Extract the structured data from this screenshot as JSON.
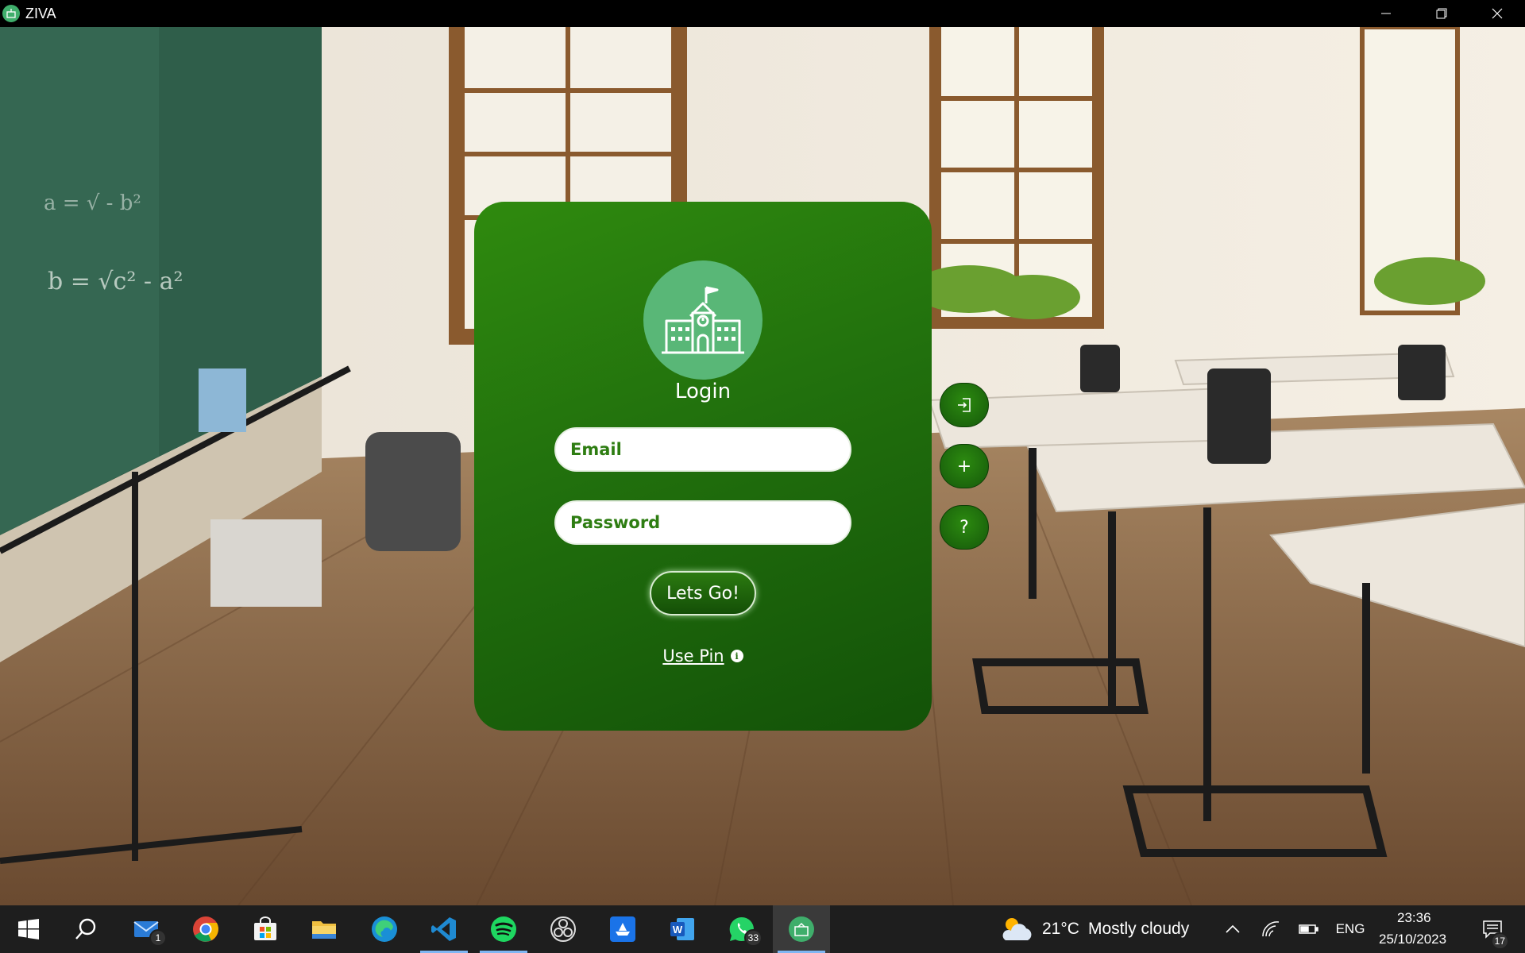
{
  "window": {
    "title": "ZIVA"
  },
  "login": {
    "title": "Login",
    "email_placeholder": "Email",
    "password_placeholder": "Password",
    "submit_label": "Lets Go!",
    "use_pin_label": "Use Pin",
    "info_glyph": "i"
  },
  "side_buttons": [
    {
      "name": "login",
      "icon": "sign-in-icon"
    },
    {
      "name": "add",
      "glyph": "+"
    },
    {
      "name": "help",
      "glyph": "?"
    }
  ],
  "taskbar": {
    "apps": [
      {
        "name": "start",
        "icon": "windows-icon"
      },
      {
        "name": "search",
        "icon": "search-icon"
      },
      {
        "name": "mail",
        "icon": "mail-icon",
        "badge": "1"
      },
      {
        "name": "chrome",
        "icon": "chrome-icon"
      },
      {
        "name": "store",
        "icon": "store-icon"
      },
      {
        "name": "file-explorer",
        "icon": "folder-icon"
      },
      {
        "name": "edge",
        "icon": "edge-icon"
      },
      {
        "name": "vscode",
        "icon": "vscode-icon"
      },
      {
        "name": "spotify",
        "icon": "spotify-icon"
      },
      {
        "name": "obs",
        "icon": "obs-icon"
      },
      {
        "name": "boat-app",
        "icon": "boat-icon"
      },
      {
        "name": "word",
        "icon": "word-icon"
      },
      {
        "name": "whatsapp",
        "icon": "whatsapp-icon",
        "badge": "33"
      },
      {
        "name": "ziva",
        "icon": "school-icon"
      }
    ],
    "weather": {
      "temperature": "21°C",
      "condition": "Mostly cloudy"
    },
    "language": "ENG",
    "time": "23:36",
    "date": "25/10/2023",
    "notifications_count": "17"
  },
  "colors": {
    "card_green": "#21700d",
    "logo_green": "#59b777",
    "text_green": "#2e7d12",
    "taskbar": "#1e1e1e"
  }
}
